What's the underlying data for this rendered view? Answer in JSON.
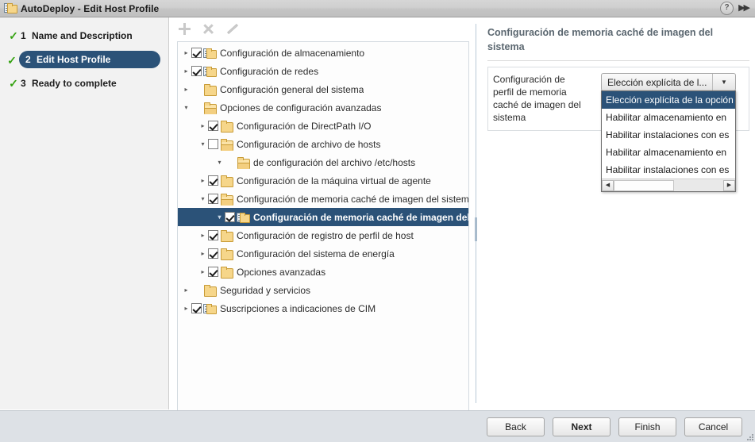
{
  "window": {
    "title": "AutoDeploy - Edit Host Profile",
    "icon": "host-profile-icon",
    "help_label": "?",
    "expand_label": "▶▶"
  },
  "sidebar": {
    "steps": [
      {
        "num": "1",
        "label": "Name and Description",
        "check": "✓",
        "active": false
      },
      {
        "num": "2",
        "label": "Edit Host Profile",
        "check": "✓",
        "active": true
      },
      {
        "num": "3",
        "label": "Ready to complete",
        "check": "✓",
        "active": false
      }
    ]
  },
  "toolbar": {
    "add_label": "+",
    "remove_label": "✕",
    "edit_label": "edit-pencil"
  },
  "tree": {
    "rows": [
      {
        "indent": 0,
        "arrow": "▸",
        "checkbox": "checked",
        "icon": "host-profile-icon",
        "label": "Configuración de almacenamiento",
        "selected": false
      },
      {
        "indent": 0,
        "arrow": "▸",
        "checkbox": "checked",
        "icon": "host-profile-icon",
        "label": "Configuración de redes",
        "selected": false
      },
      {
        "indent": 0,
        "arrow": "▸",
        "checkbox": "none",
        "icon": "folder-closed",
        "label": "Configuración general del sistema",
        "selected": false
      },
      {
        "indent": 0,
        "arrow": "▾",
        "checkbox": "none",
        "icon": "folder-open",
        "label": "Opciones de configuración avanzadas",
        "selected": false
      },
      {
        "indent": 1,
        "arrow": "▸",
        "checkbox": "checked",
        "icon": "folder-closed",
        "label": "Configuración de DirectPath I/O",
        "selected": false
      },
      {
        "indent": 1,
        "arrow": "▾",
        "checkbox": "unchecked",
        "icon": "folder-open",
        "label": "Configuración de archivo de hosts",
        "selected": false
      },
      {
        "indent": 2,
        "arrow": "▾",
        "checkbox": "none",
        "icon": "folder-open",
        "label": "de configuración del archivo /etc/hosts",
        "selected": false
      },
      {
        "indent": 1,
        "arrow": "▸",
        "checkbox": "checked",
        "icon": "folder-closed",
        "label": "Configuración de la máquina virtual de agente",
        "selected": false
      },
      {
        "indent": 1,
        "arrow": "▾",
        "checkbox": "checked",
        "icon": "folder-open",
        "label": "Configuración de memoria caché de imagen del sistema",
        "selected": false
      },
      {
        "indent": 2,
        "arrow": "▾",
        "checkbox": "checked",
        "icon": "host-profile-icon",
        "label": "Configuración de memoria caché de imagen del sistema",
        "selected": true
      },
      {
        "indent": 1,
        "arrow": "▸",
        "checkbox": "checked",
        "icon": "folder-closed",
        "label": "Configuración de registro de perfil de host",
        "selected": false
      },
      {
        "indent": 1,
        "arrow": "▸",
        "checkbox": "checked",
        "icon": "folder-closed",
        "label": "Configuración del sistema de energía",
        "selected": false
      },
      {
        "indent": 1,
        "arrow": "▸",
        "checkbox": "checked",
        "icon": "folder-closed",
        "label": "Opciones avanzadas",
        "selected": false
      },
      {
        "indent": 0,
        "arrow": "▸",
        "checkbox": "none",
        "icon": "folder-closed",
        "label": "Seguridad y servicios",
        "selected": false
      },
      {
        "indent": 0,
        "arrow": "▸",
        "checkbox": "checked",
        "icon": "host-profile-icon",
        "label": "Suscripciones a indicaciones de CIM",
        "selected": false
      }
    ]
  },
  "detail": {
    "title": "Configuración de memoria caché de imagen del sistema",
    "field_label": "Configuración de perfil de memoria caché de imagen del sistema",
    "combo": {
      "value": "Elección explícita de l...",
      "arrow": "▼",
      "open": true,
      "options": [
        {
          "label": "Elección explícita de la opción",
          "selected": true
        },
        {
          "label": "Habilitar almacenamiento en",
          "selected": false
        },
        {
          "label": "Habilitar instalaciones con es",
          "selected": false
        },
        {
          "label": "Habilitar almacenamiento en",
          "selected": false
        },
        {
          "label": "Habilitar instalaciones con es",
          "selected": false
        }
      ],
      "scroll_left": "◀",
      "scroll_right": "▶"
    }
  },
  "footer": {
    "buttons": [
      {
        "label": "Back",
        "primary": false
      },
      {
        "label": "Next",
        "primary": true
      },
      {
        "label": "Finish",
        "primary": false
      },
      {
        "label": "Cancel",
        "primary": false
      }
    ]
  },
  "colors": {
    "accent": "#2b5278",
    "check_green": "#36a313",
    "folder": "#f6d68a",
    "titlebar": "#cfcfcf",
    "footer": "#dde1e6"
  }
}
